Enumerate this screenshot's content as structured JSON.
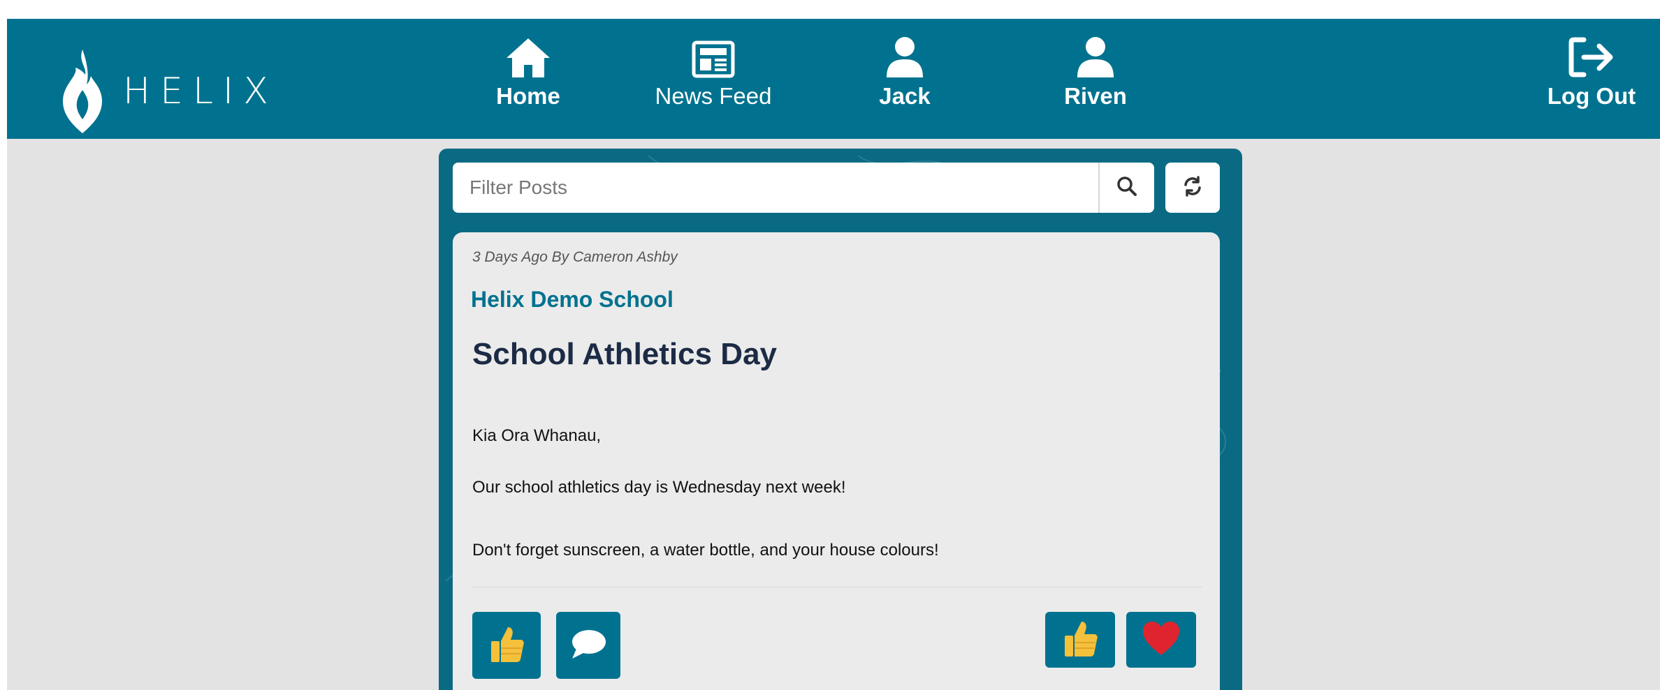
{
  "app": {
    "logo_text": "HELIX"
  },
  "nav": {
    "items": [
      {
        "label": "Home",
        "icon": "home-icon"
      },
      {
        "label": "News Feed",
        "icon": "newspaper-icon"
      },
      {
        "label": "Jack",
        "icon": "user-icon"
      },
      {
        "label": "Riven",
        "icon": "user-icon"
      }
    ],
    "logout_label": "Log Out",
    "logout_icon": "logout-icon"
  },
  "feed": {
    "search": {
      "placeholder": "Filter Posts",
      "search_icon": "search-icon",
      "refresh_icon": "refresh-icon"
    },
    "post": {
      "meta": "3 Days Ago By Cameron Ashby",
      "school": "Helix Demo School",
      "title": "School Athletics Day",
      "body": [
        "Kia Ora Whanau,",
        "Our school athletics day is Wednesday next week!",
        "Don't forget sunscreen, a water bottle, and your house colours!"
      ],
      "actions": {
        "like_icon": "thumbs-up-icon",
        "comment_icon": "comment-icon"
      },
      "reactions": [
        {
          "icon": "thumbs-up-icon"
        },
        {
          "icon": "heart-icon"
        }
      ]
    }
  },
  "colors": {
    "brand": "#00728f",
    "background": "#e3e3e3",
    "title": "#1c2b45",
    "heart": "#e0242f",
    "thumb": "#f5c13b"
  }
}
